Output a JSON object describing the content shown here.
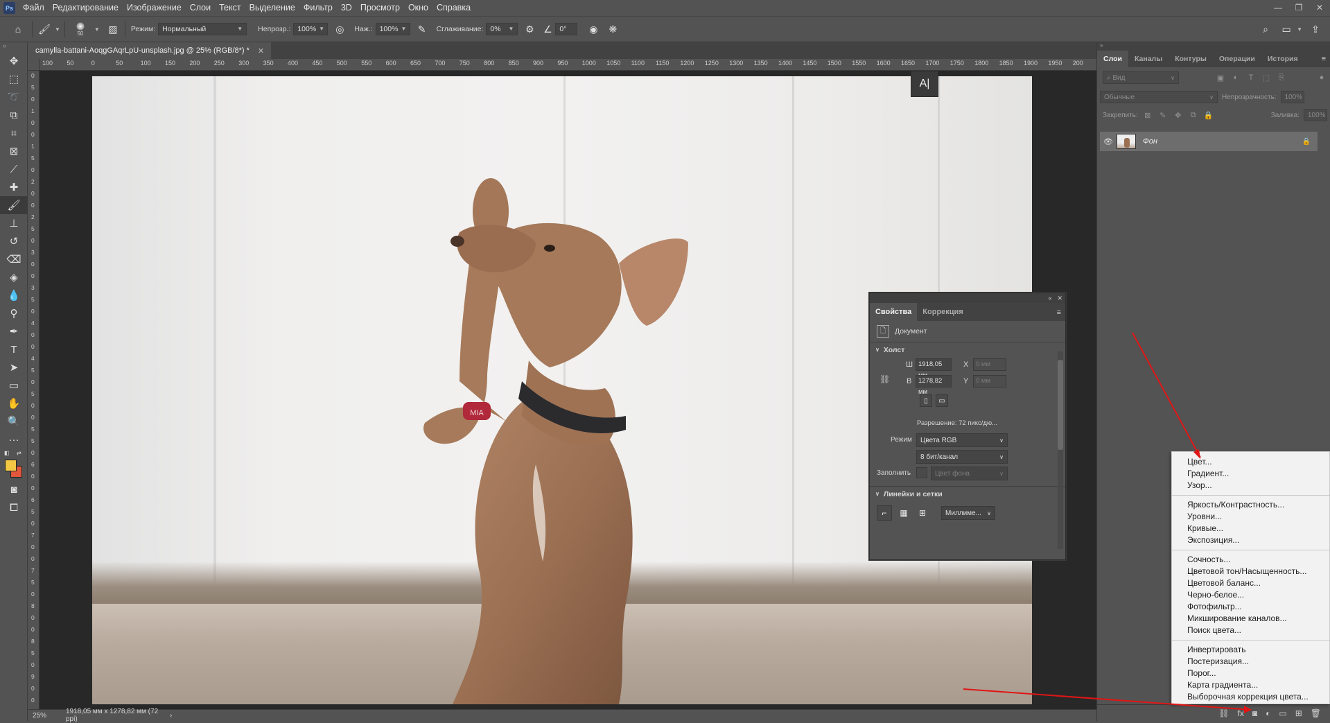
{
  "menubar": {
    "logo": "Ps",
    "items": [
      "Файл",
      "Редактирование",
      "Изображение",
      "Слои",
      "Текст",
      "Выделение",
      "Фильтр",
      "3D",
      "Просмотр",
      "Окно",
      "Справка"
    ]
  },
  "options": {
    "brush_size": "50",
    "mode_label": "Режим:",
    "mode_value": "Нормальный",
    "opacity_label": "Непрозр.:",
    "opacity_value": "100%",
    "pressure_label": "Наж.:",
    "pressure_value": "100%",
    "smoothing_label": "Сглаживание:",
    "smoothing_value": "0%",
    "angle_value": "0°"
  },
  "document": {
    "tab_title": "camylla-battani-AoqgGAqrLpU-unsplash.jpg @ 25% (RGB/8*) *",
    "ruler_h": [
      "100",
      "50",
      "0",
      "50",
      "100",
      "150",
      "200",
      "250",
      "300",
      "350",
      "400",
      "450",
      "500",
      "550",
      "600",
      "650",
      "700",
      "750",
      "800",
      "850",
      "900",
      "950",
      "1000",
      "1050",
      "1100",
      "1150",
      "1200",
      "1250",
      "1300",
      "1350",
      "1400",
      "1450",
      "1500",
      "1550",
      "1600",
      "1650",
      "1700",
      "1750",
      "1800",
      "1850",
      "1900",
      "1950",
      "200"
    ],
    "ruler_v": [
      "0",
      "5",
      "0",
      "1",
      "0",
      "0",
      "1",
      "5",
      "0",
      "2",
      "0",
      "0",
      "2",
      "5",
      "0",
      "3",
      "0",
      "0",
      "3",
      "5",
      "0",
      "4",
      "0",
      "0",
      "4",
      "5",
      "0",
      "5",
      "0",
      "0",
      "5",
      "5",
      "0",
      "6",
      "0",
      "0",
      "6",
      "5",
      "0",
      "7",
      "0",
      "0",
      "7",
      "5",
      "0",
      "8",
      "0",
      "0",
      "8",
      "5",
      "0",
      "9",
      "0",
      "0"
    ],
    "floating_text_icon": "A|",
    "collar_tag": "MIA"
  },
  "status": {
    "zoom": "25%",
    "info": "1918,05 мм x 1278,82 мм (72 ppi)",
    "arrow": "›"
  },
  "properties_panel": {
    "tabs": [
      "Свойства",
      "Коррекция"
    ],
    "doc_label": "Документ",
    "canvas_section": "Холст",
    "w_label": "Ш",
    "w_value": "1918,05 мм",
    "h_label": "В",
    "h_value": "1278,82 мм",
    "x_label": "X",
    "x_value": "0 мм",
    "y_label": "Y",
    "y_value": "0 мм",
    "resolution": "Разрешение: 72 пикс/дю...",
    "mode_label": "Режим",
    "mode_value": "Цвета RGB",
    "bits_value": "8 бит/канал",
    "fill_label": "Заполнить",
    "fill_value": "Цвет фона",
    "rulers_section": "Линейки и сетки",
    "units_value": "Миллиме..."
  },
  "layers_panel": {
    "tabs": [
      "Слои",
      "Каналы",
      "Контуры",
      "Операции",
      "История"
    ],
    "search_placeholder": "Вид",
    "blend_mode": "Обычные",
    "opacity_label": "Непрозрачность:",
    "opacity_value": "100%",
    "lock_label": "Закрепить:",
    "fill_label": "Заливка:",
    "fill_value": "100%",
    "layer_name": "Фон"
  },
  "adjustment_menu": {
    "group1": [
      "Цвет...",
      "Градиент...",
      "Узор..."
    ],
    "group2": [
      "Яркость/Контрастность...",
      "Уровни...",
      "Кривые...",
      "Экспозиция..."
    ],
    "group3": [
      "Сочность...",
      "Цветовой тон/Насыщенность...",
      "Цветовой баланс...",
      "Черно-белое...",
      "Фотофильтр...",
      "Микширование каналов...",
      "Поиск цвета..."
    ],
    "group4": [
      "Инвертировать",
      "Постеризация...",
      "Порог...",
      "Карта градиента...",
      "Выборочная коррекция цвета..."
    ]
  },
  "colors": {
    "foreground": "#f2c744",
    "background": "#e0573c",
    "annotation_arrow": "#e01515"
  }
}
